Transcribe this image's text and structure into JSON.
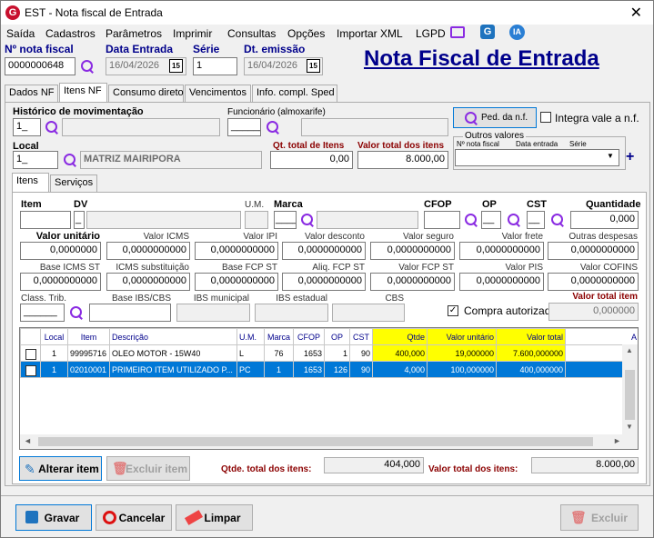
{
  "window": {
    "title": "EST - Nota fiscal de Entrada",
    "icon_letter": "G"
  },
  "menu": [
    "Saída",
    "Cadastros",
    "Parâmetros",
    "Imprimir",
    "Consultas",
    "Opções",
    "Importar XML",
    "LGPD"
  ],
  "menu_icons": {
    "ia": "IA"
  },
  "header": {
    "nota_fiscal_label": "Nº nota fiscal",
    "nota_fiscal_value": "0000000648",
    "data_entrada_label": "Data Entrada",
    "data_entrada_value": "16/04/2026",
    "serie_label": "Série",
    "serie_value": "1",
    "dt_emissao_label": "Dt. emissão",
    "dt_emissao_value": "16/04/2026",
    "cal_glyph": "15",
    "big_title": "Nota Fiscal de Entrada"
  },
  "main_tabs": [
    "Dados NF",
    "Itens NF",
    "Consumo direto",
    "Vencimentos",
    "Info. compl. Sped"
  ],
  "itens_nf": {
    "historico_label": "Histórico de movimentação",
    "historico_value": "1_",
    "funcionario_label": "Funcionário (almoxarife)",
    "funcionario_value": "______",
    "ped_label": "Ped. da n.f.",
    "integra_label": "Integra vale a n.f.",
    "local_label": "Local",
    "local_value": "1_",
    "local_name": "MATRIZ MAIRIPORA",
    "qt_total_label": "Qt. total de Itens",
    "qt_total_value": "0,00",
    "valor_total_label": "Valor total dos itens",
    "valor_total_value": "8.000,00",
    "outros_label": "Outros valores",
    "outros_cols": [
      "Nº nota fiscal",
      "Data entrada",
      "Série"
    ],
    "plus": "+"
  },
  "sub_tabs": [
    "Itens",
    "Serviços"
  ],
  "item_form": {
    "row1_labels": [
      "Item",
      "DV",
      "U.M.",
      "Marca",
      "CFOP",
      "OP",
      "CST",
      "Quantidade"
    ],
    "dv_value": "_",
    "marca_value": "____",
    "op_value": "__",
    "cst_value": "__",
    "quantidade_value": "0,000",
    "row2": [
      {
        "label": "Valor unitário",
        "value": "0,0000000"
      },
      {
        "label": "Valor ICMS",
        "value": "0,0000000000"
      },
      {
        "label": "Valor IPI",
        "value": "0,0000000000"
      },
      {
        "label": "Valor desconto",
        "value": "0,0000000000"
      },
      {
        "label": "Valor seguro",
        "value": "0,0000000000"
      },
      {
        "label": "Valor frete",
        "value": "0,0000000000"
      },
      {
        "label": "Outras despesas",
        "value": "0,0000000000"
      }
    ],
    "row3": [
      {
        "label": "Base ICMS ST",
        "value": "0,0000000000"
      },
      {
        "label": "ICMS substituição",
        "value": "0,0000000000"
      },
      {
        "label": "Base FCP ST",
        "value": "0,0000000000"
      },
      {
        "label": "Aliq. FCP ST",
        "value": "0,0000000000"
      },
      {
        "label": "Valor FCP ST",
        "value": "0,0000000000"
      },
      {
        "label": "Valor PIS",
        "value": "0,0000000000"
      },
      {
        "label": "Valor COFINS",
        "value": "0,0000000000"
      }
    ],
    "class_trib_label": "Class. Trib.",
    "class_trib_value": "______",
    "base_ibs_label": "Base IBS/CBS",
    "ibs_mun_label": "IBS municipal",
    "ibs_est_label": "IBS estadual",
    "cbs_label": "CBS",
    "compra_autorizada_label": "Compra autorizada",
    "compra_check": "✓",
    "valor_total_item_label": "Valor total item",
    "valor_total_item_value": "0,000000"
  },
  "grid": {
    "columns": [
      "",
      "Local",
      "Item",
      "Descrição",
      "U.M.",
      "Marca",
      "CFOP",
      "OP",
      "CST",
      "Qtde",
      "Valor unitário",
      "Valor total",
      "A"
    ],
    "rows": [
      [
        "",
        "1",
        "99995716",
        "OLEO MOTOR - 15W40",
        "L",
        "76",
        "1653",
        "1",
        "90",
        "400,000",
        "19,000000",
        "7.600,000000",
        ""
      ],
      [
        "",
        "1",
        "02010001",
        "PRIMEIRO ITEM UTILIZADO P...",
        "PC",
        "1",
        "1653",
        "126",
        "90",
        "4,000",
        "100,000000",
        "400,000000",
        ""
      ]
    ],
    "selected_row": 1,
    "scroll_up": "▲",
    "scroll_down": "▼",
    "scroll_left": "◄",
    "scroll_right": "►"
  },
  "grid_footer": {
    "alterar_label": "Alterar item",
    "excluir_label": "Excluir item",
    "qtde_total_label": "Qtde. total dos itens:",
    "qtde_total_value": "404,000",
    "valor_total_label": "Valor total dos itens:",
    "valor_total_value": "8.000,00"
  },
  "bottom": {
    "gravar": "Gravar",
    "cancelar": "Cancelar",
    "limpar": "Limpar",
    "excluir": "Excluir"
  },
  "colors": {
    "accent_blue": "#00008b",
    "red_label": "#8b0000",
    "selection": "#0078d7",
    "highlight_yellow": "#ffff00",
    "search_purple": "#8a2be2"
  }
}
